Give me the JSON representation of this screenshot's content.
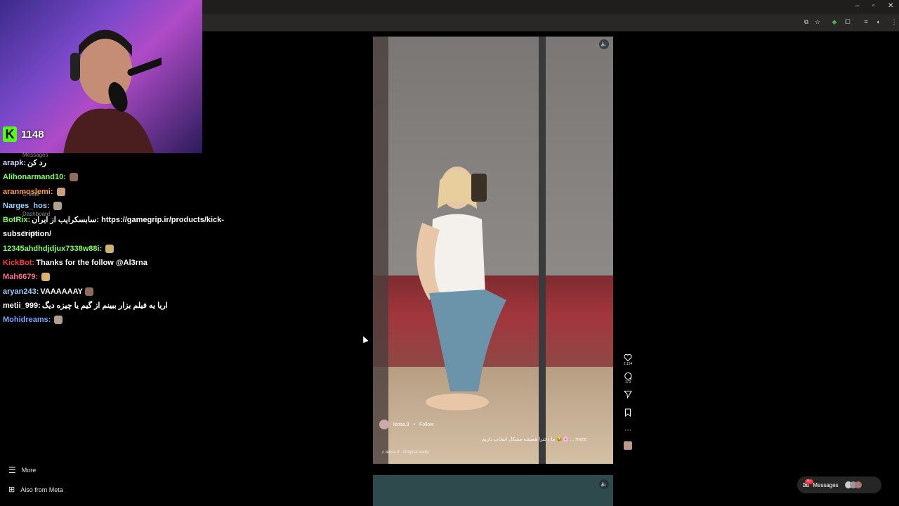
{
  "stream": {
    "viewer_count": "1148",
    "platform_logo_letter": "K"
  },
  "chat": [
    {
      "user": "arapk:",
      "user_color": "#d6d6ff",
      "text": "رد کن"
    },
    {
      "user": "Alihonarmand10:",
      "user_color": "#7cff5a",
      "text": ""
    },
    {
      "user": "aranmoslemi:",
      "user_color": "#ff9a3d",
      "text": ""
    },
    {
      "user": "Narges_hos:",
      "user_color": "#9bd0ff",
      "text": ""
    },
    {
      "user": "BotRix:",
      "user_color": "#7cff5a",
      "text": "سابسکرایب از ایران: https://gamegrip.ir/products/kick-subscription/"
    },
    {
      "user": "12345ahdhdjdjux7338w88i:",
      "user_color": "#7cff5a",
      "text": ""
    },
    {
      "user": "KickBot:",
      "user_color": "#ff3b3b",
      "text": "Thanks for the follow @Al3rna"
    },
    {
      "user": "Mah6679:",
      "user_color": "#ff6b8a",
      "text": ""
    },
    {
      "user": "aryan243:",
      "user_color": "#9bd0ff",
      "text": "VAAAAAAY"
    },
    {
      "user": "metii_999:",
      "user_color": "#ffffff",
      "text": "اریا یه فیلم بزار ببینم از گیم یا چیزه دیگ"
    },
    {
      "user": "Mohidreams:",
      "user_color": "#7aa6ff",
      "text": ""
    }
  ],
  "ig_sidebar": {
    "messages": "Messages",
    "create": "Create",
    "dashboard": "Dashboard",
    "profile": "Profile",
    "more": "More",
    "also_from_meta": "Also from Meta"
  },
  "reel": {
    "author": "leosa.9",
    "follow": "Follow",
    "caption": "ما دخترا همیشه مشکل انتخاب داریم 😂🌸 ... more",
    "audio": "leosa.9 · Original audio",
    "likes": "2,154",
    "comments": "173"
  },
  "messages_button": {
    "label": "Messages",
    "badge": "9+"
  },
  "colors": {
    "kick_green": "#53fc18",
    "notification_red": "#ff3040"
  }
}
